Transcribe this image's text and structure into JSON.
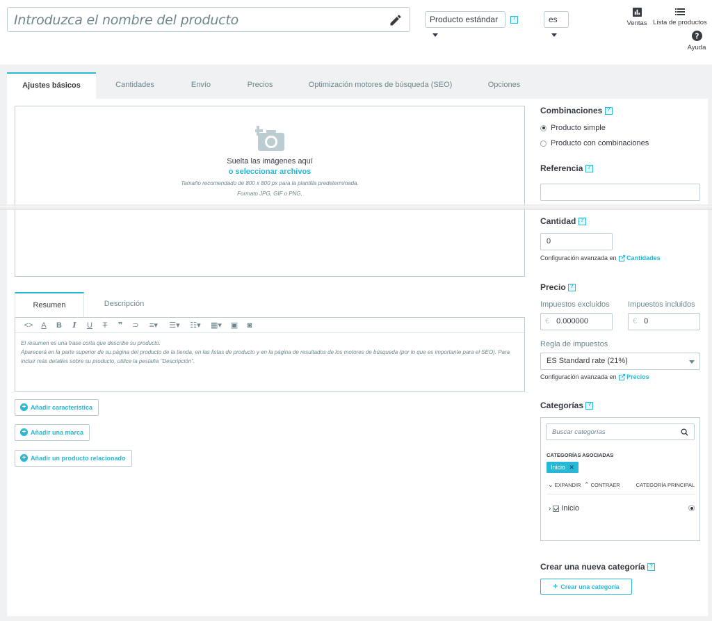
{
  "header": {
    "name_placeholder": "Introduzca el nombre del producto",
    "product_type": "Producto estándar",
    "language": "es",
    "sales_label": "Ventas",
    "product_list_label": "Lista de productos",
    "help_label": "Ayuda"
  },
  "tabs": [
    {
      "label": "Ajustes básicos",
      "active": true
    },
    {
      "label": "Cantidades"
    },
    {
      "label": "Envío"
    },
    {
      "label": "Precios"
    },
    {
      "label": "Optimización motores de búsqueda (SEO)"
    },
    {
      "label": "Opciones"
    }
  ],
  "dropzone": {
    "line1": "Suelta las imágenes aquí",
    "link": "o seleccionar archivos",
    "line3": "Tamaño recomendado de 800 x 800 px para la plantilla predeterminada.",
    "line4": "Formato JPG, GIF o PNG."
  },
  "editor": {
    "tabs": [
      "Resumen",
      "Descripción"
    ],
    "text": [
      "El resumen es una frase corta que describe su producto.",
      "Aparecerá en la parte superior de su página del producto de la tienda, en las listas de producto y en la página de resultados de los motores de búsqueda (por lo que es importante para el SEO). Para incluir más detalles sobre su producto, utilice la pestaña \"Descripción\"."
    ]
  },
  "buttons": {
    "add_feature": "Añadir característica",
    "add_brand": "Añadir una marca",
    "add_related": "Añadir un producto relacionado"
  },
  "right": {
    "combinations_title": "Combinaciones",
    "simple_product": "Producto simple",
    "with_combinations": "Producto con combinaciones",
    "reference_title": "Referencia",
    "reference_value": "",
    "quantity_title": "Cantidad",
    "quantity_value": "0",
    "advanced_config": "Configuración avanzada en",
    "quantities_link": "Cantidades",
    "price_title": "Precio",
    "tax_excluded_label": "Impuestos excluidos",
    "tax_included_label": "Impuestos incluidos",
    "currency": "€",
    "price_excl": "0.000000",
    "price_incl": "0",
    "tax_rule_label": "Regla de impuestos",
    "tax_rule_value": "ES Standard rate (21%)",
    "prices_link": "Precios",
    "categories_title": "Categorías",
    "search_placeholder": "Buscar categorías",
    "associated_label": "CATEGORÍAS ASOCIADAS",
    "chip_label": "Inicio",
    "expand_label": "EXPANDIR",
    "collapse_label": "CONTRAER",
    "main_category_label": "CATEGORÍA PRINCIPAL",
    "tree_item": "Inicio",
    "new_category_title": "Crear una nueva categoría",
    "create_category_button": "Crear una categoría"
  },
  "colors": {
    "accent": "#25b9d7",
    "border": "#bbcdd2",
    "text": "#363a41",
    "muted": "#6c868e"
  }
}
